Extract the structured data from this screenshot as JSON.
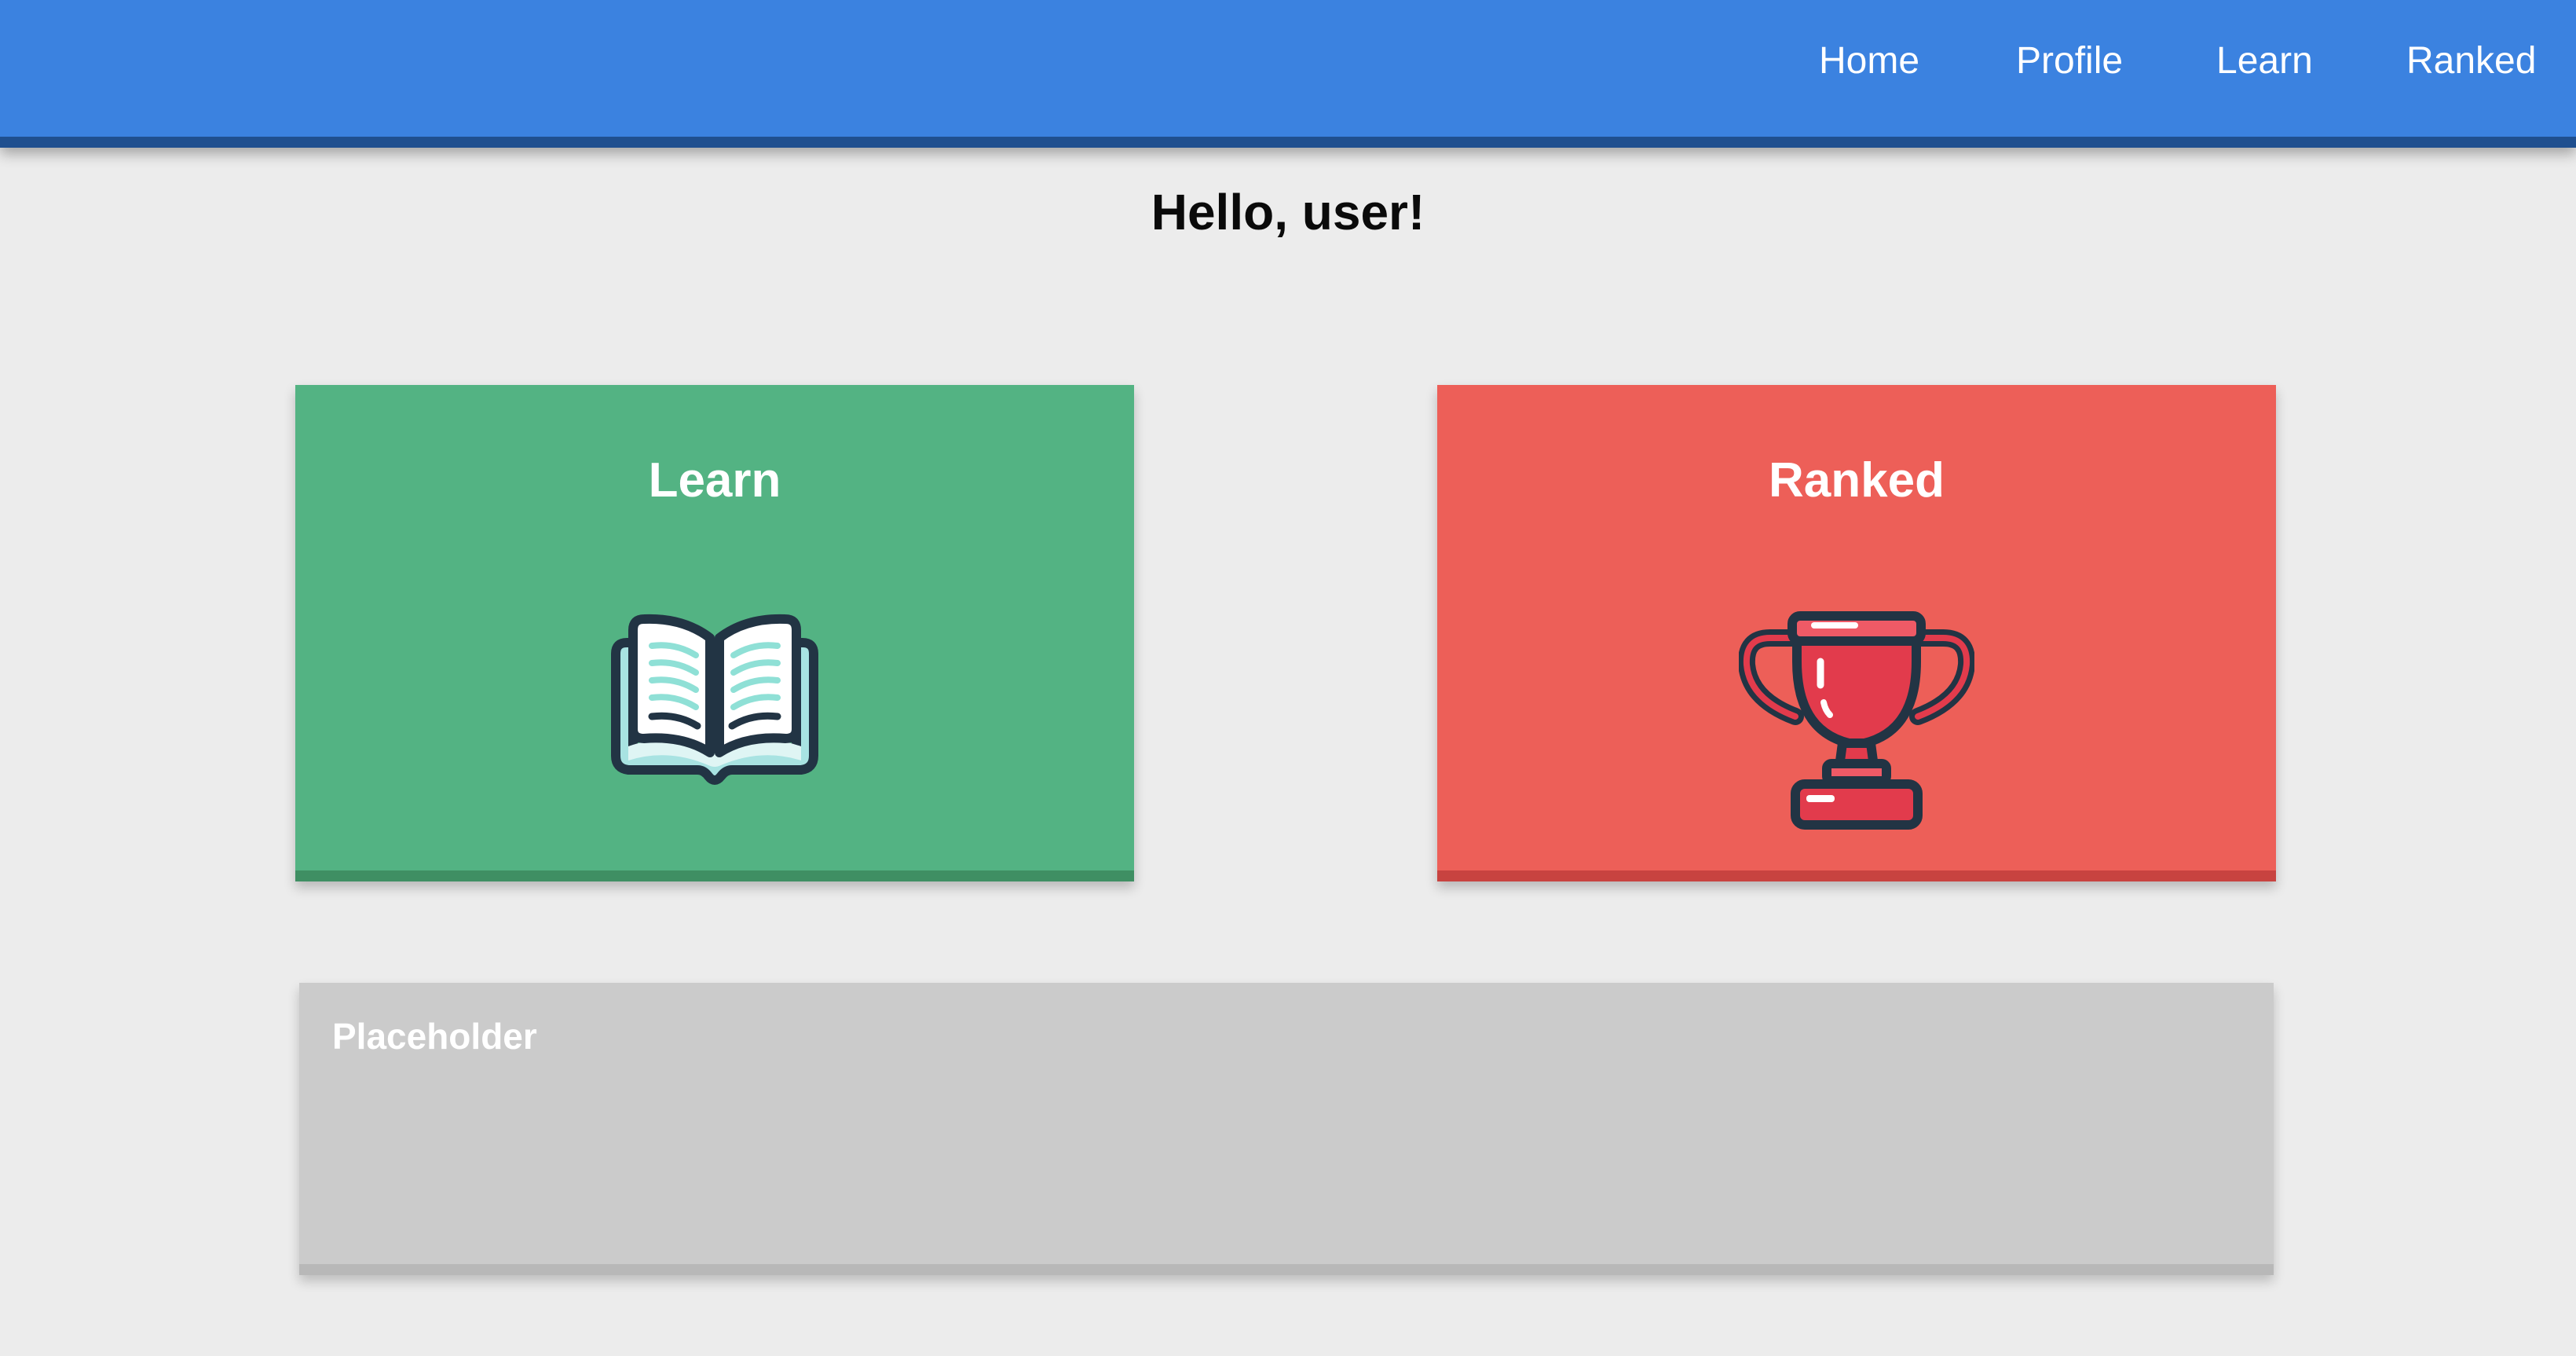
{
  "navbar": {
    "links": [
      {
        "label": "Home"
      },
      {
        "label": "Profile"
      },
      {
        "label": "Learn"
      },
      {
        "label": "Ranked"
      }
    ],
    "colors": {
      "background": "#3b82e0",
      "text": "#ffffff"
    }
  },
  "greeting": "Hello, user!",
  "cards": {
    "learn": {
      "title": "Learn",
      "icon": "open-book-icon",
      "color": "#53b383"
    },
    "ranked": {
      "title": "Ranked",
      "icon": "trophy-icon",
      "color": "#ed5f58"
    }
  },
  "placeholder": {
    "label": "Placeholder",
    "color": "#cbcbcb"
  }
}
